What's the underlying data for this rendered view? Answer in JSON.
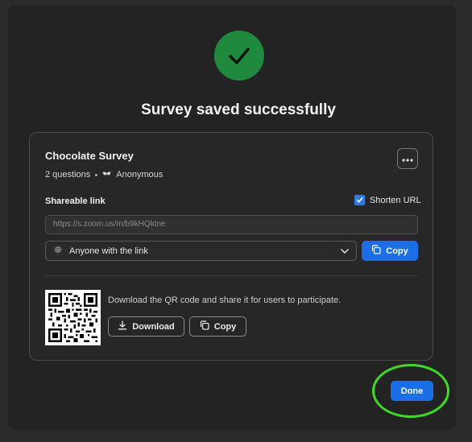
{
  "dialog": {
    "title": "Survey saved successfully"
  },
  "card": {
    "survey_name": "Chocolate Survey",
    "question_count": "2 questions",
    "anonymity": "Anonymous",
    "shareable_label": "Shareable link",
    "shorten_url_label": "Shorten URL",
    "shorten_url_checked": true,
    "url": "https://s.zoom.us/m/b9kHQktne",
    "access_option": "Anyone with the link",
    "copy_link_label": "Copy",
    "qr_description": "Download the QR code and share it for users to participate.",
    "download_label": "Download",
    "copy_qr_label": "Copy"
  },
  "footer": {
    "done_label": "Done"
  },
  "colors": {
    "accent": "#1a6fe8",
    "success": "#1f8a3e",
    "highlight": "#3cdc1e"
  }
}
